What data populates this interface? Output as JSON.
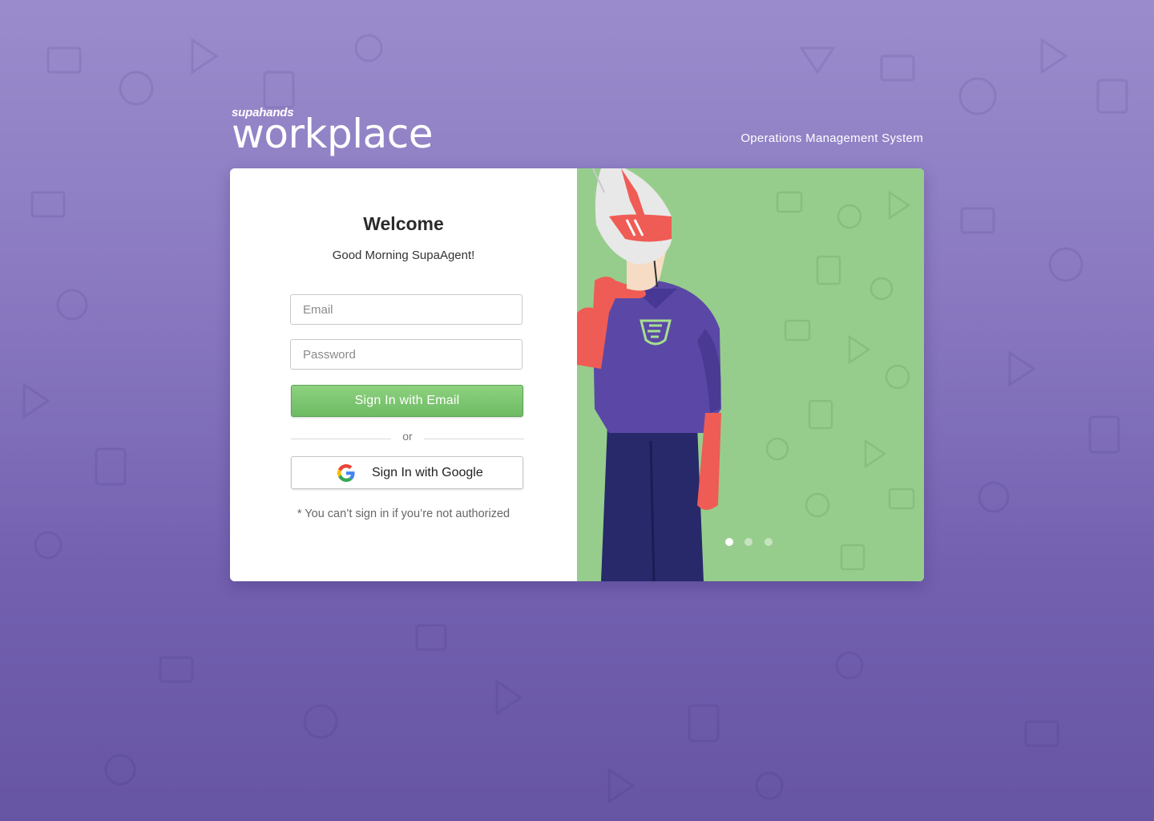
{
  "brand": {
    "small": "supahands",
    "name": "workplace",
    "tagline": "Operations Management System"
  },
  "login": {
    "title": "Welcome",
    "greeting": "Good Morning SupaAgent!",
    "email_placeholder": "Email",
    "password_placeholder": "Password",
    "email_button": "Sign In with Email",
    "or_label": "or",
    "google_button": "Sign In with Google",
    "note": "* You can’t sign in if you’re not authorized"
  },
  "carousel": {
    "slide_count": 3,
    "active_index": 0
  },
  "colors": {
    "background": "#8a79c1",
    "panel_green": "#97cd8c",
    "button_green": "#6dbb63",
    "hero_purple": "#5b48a6",
    "hero_navy": "#27296b",
    "hero_red": "#ef5c55"
  }
}
